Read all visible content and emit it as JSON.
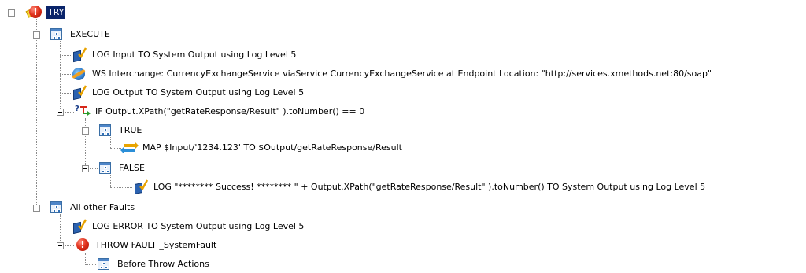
{
  "tree": {
    "try": "TRY",
    "execute": "EXECUTE",
    "log_input": "LOG Input TO System Output using Log Level 5",
    "ws_interchange": "WS Interchange: CurrencyExchangeService viaService CurrencyExchangeService at Endpoint Location: \"http://services.xmethods.net:80/soap\"",
    "log_output": "LOG Output TO System Output using Log Level 5",
    "if_condition": "IF Output.XPath(\"getRateResponse/Result\" ).toNumber() == 0",
    "true_branch": "TRUE",
    "map_statement": "MAP $Input/'1234.123' TO $Output/getRateResponse/Result",
    "false_branch": "FALSE",
    "log_success": "LOG \"******** Success! ******** \" + Output.XPath(\"getRateResponse/Result\" ).toNumber() TO System Output using Log Level 5",
    "all_other_faults": "All other Faults",
    "log_error": "LOG ERROR TO System Output using Log Level 5",
    "throw_fault": "THROW FAULT _SystemFault",
    "before_throw": "Before Throw Actions"
  },
  "icons": {
    "try": "try-fault-icon",
    "group": "group-icon",
    "log": "log-icon",
    "ws": "web-service-icon",
    "if": "if-condition-icon",
    "map": "map-icon",
    "fault": "fault-icon"
  },
  "colors": {
    "selection": "#0a246a",
    "fault_red": "#e0321c",
    "group_blue": "#3a6ea5"
  }
}
